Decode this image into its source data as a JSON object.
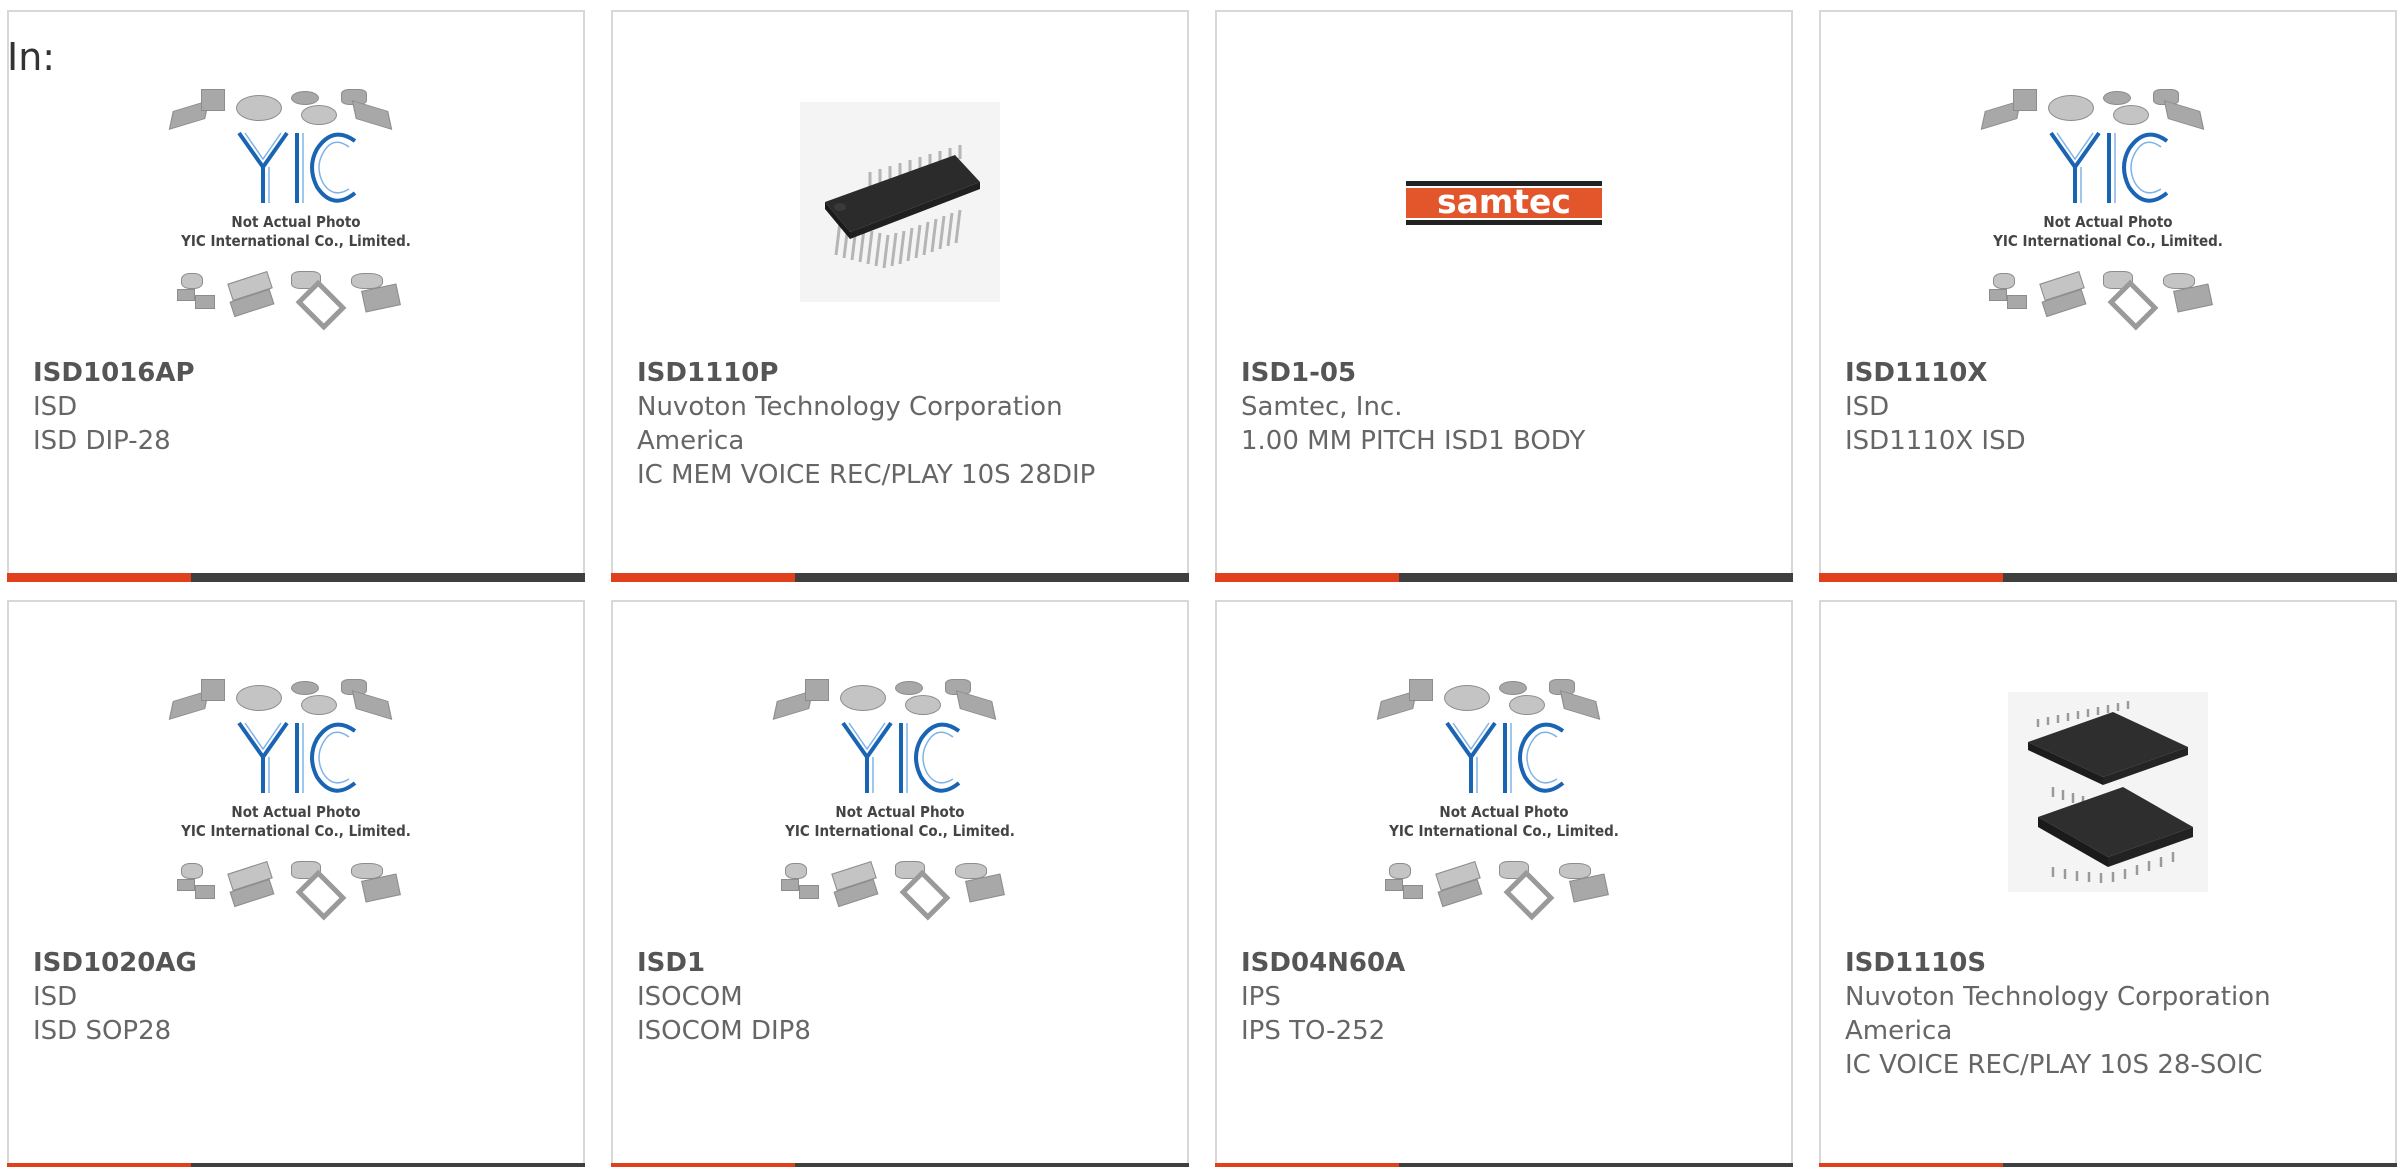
{
  "page": {
    "in_label": "In:"
  },
  "placeholder": {
    "line1": "Not Actual Photo",
    "line2": "YIC International Co., Limited."
  },
  "logo_text": "samtec",
  "cards": [
    {
      "part": "ISD1016AP",
      "maker": "ISD",
      "desc": "ISD DIP-28",
      "image": "yic-placeholder"
    },
    {
      "part": "ISD1110P",
      "maker": "Nuvoton Technology Corporation America",
      "desc": "IC MEM VOICE REC/PLAY 10S 28DIP",
      "image": "dip-chip-photo"
    },
    {
      "part": "ISD1-05",
      "maker": "Samtec, Inc.",
      "desc": "1.00 MM PITCH ISD1 BODY",
      "image": "samtec-logo"
    },
    {
      "part": "ISD1110X",
      "maker": "ISD",
      "desc": "ISD1110X ISD",
      "image": "yic-placeholder"
    },
    {
      "part": "ISD1020AG",
      "maker": "ISD",
      "desc": "ISD SOP28",
      "image": "yic-placeholder"
    },
    {
      "part": "ISD1",
      "maker": "ISOCOM",
      "desc": "ISOCOM DIP8",
      "image": "yic-placeholder"
    },
    {
      "part": "ISD04N60A",
      "maker": "IPS",
      "desc": "IPS TO-252",
      "image": "yic-placeholder"
    },
    {
      "part": "ISD1110S",
      "maker": "Nuvoton Technology Corporation America",
      "desc": "IC VOICE REC/PLAY 10S 28-SOIC",
      "image": "soic-chip-photo"
    }
  ],
  "colors": {
    "accent": "#e0401c",
    "bar": "#3f3f3f",
    "border": "#d8d8d8",
    "text": "#666666",
    "yic_blue": "#1a64b4"
  }
}
